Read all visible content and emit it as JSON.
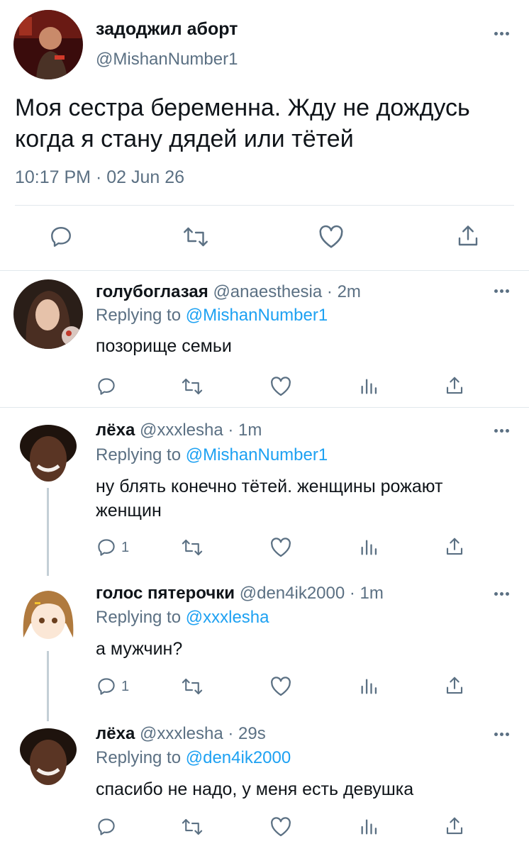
{
  "colors": {
    "text": "#0f1419",
    "secondary": "#5b7083",
    "link": "#1da1f2",
    "divider": "#e1e8ed"
  },
  "main_tweet": {
    "name": "задоджил аборт",
    "handle": "@MishanNumber1",
    "text": "Моя сестра беременна. Жду не дождусь когда я стану дядей или тётей",
    "timestamp": "10:17 PM · 02 Jun 26",
    "icons": [
      "reply-icon",
      "retweet-icon",
      "like-icon",
      "share-icon"
    ]
  },
  "replies": [
    {
      "name": "голубоглазая",
      "meta": "@anaesthesia · 2m",
      "replying_prefix": "Replying to ",
      "replying_to": "@MishanNumber1",
      "text": "позорище семьи",
      "reply_count": ""
    },
    {
      "name": "лёха",
      "meta": "@xxxlesha · 1m",
      "replying_prefix": "Replying to ",
      "replying_to": "@MishanNumber1",
      "text": "ну блять конечно тётей. женщины рожают женщин",
      "reply_count": "1"
    },
    {
      "name": "голос пятерочки",
      "meta": "@den4ik2000 · 1m",
      "replying_prefix": "Replying to ",
      "replying_to": "@xxxlesha",
      "text": "а мужчин?",
      "reply_count": "1"
    },
    {
      "name": "лёха",
      "meta": "@xxxlesha · 29s",
      "replying_prefix": "Replying to ",
      "replying_to": "@den4ik2000",
      "text": "спасибо не надо, у меня есть девушка",
      "reply_count": ""
    }
  ]
}
